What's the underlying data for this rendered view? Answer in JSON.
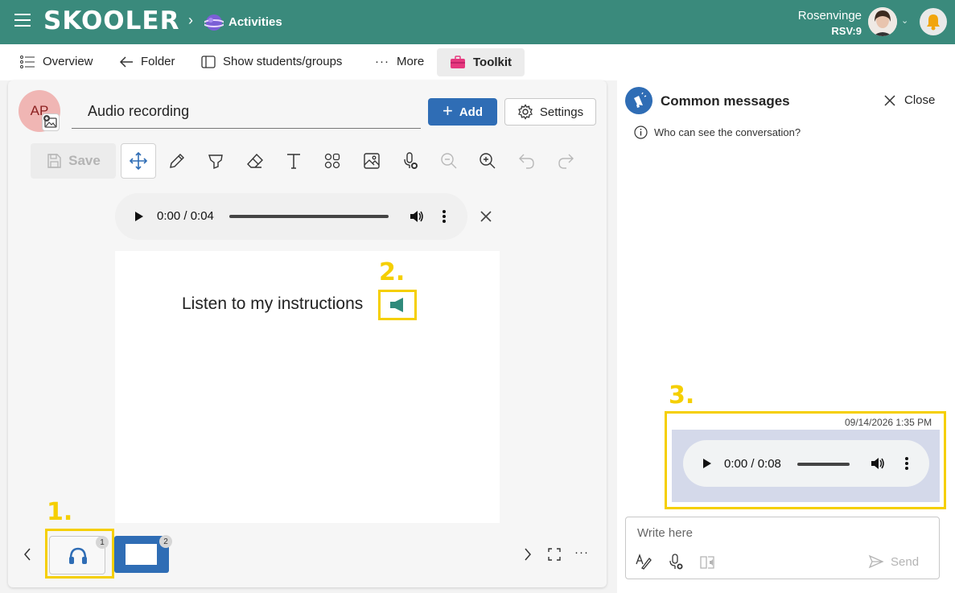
{
  "header": {
    "logo": "SKOOLER",
    "breadcrumb": "Activities",
    "user_name": "Rosenvinge",
    "user_class": "RSV:9"
  },
  "nav": {
    "overview": "Overview",
    "folder": "Folder",
    "show_students": "Show students/groups",
    "more": "More",
    "toolkit": "Toolkit"
  },
  "editor": {
    "avatar_initials": "AP",
    "title_value": "Audio recording",
    "add_label": "Add",
    "settings_label": "Settings",
    "save_label": "Save",
    "audio_time": "0:00 / 0:04",
    "slide_text": "Listen to my instructions"
  },
  "steps": {
    "one": "1.",
    "two": "2.",
    "three": "3."
  },
  "thumbnails": [
    {
      "badge": "1"
    },
    {
      "badge": "2"
    }
  ],
  "panel": {
    "title": "Common messages",
    "close_label": "Close",
    "info": "Who can see the conversation?",
    "message_timestamp": "09/14/2026 1:35 PM",
    "message_audio_time": "0:00 / 0:08",
    "compose_placeholder": "Write here",
    "send_label": "Send"
  },
  "colors": {
    "topbar": "#3a8a7c",
    "accent": "#2f6db5",
    "highlight": "#f5cf00"
  }
}
